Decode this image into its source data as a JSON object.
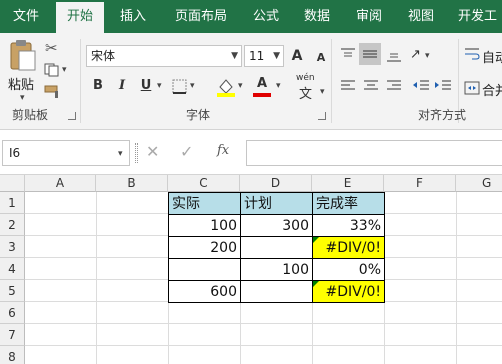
{
  "ribbon": {
    "tabs": [
      "文件",
      "开始",
      "插入",
      "页面布局",
      "公式",
      "数据",
      "审阅",
      "视图",
      "开发工"
    ],
    "active_tab": "开始",
    "clipboard": {
      "paste_label": "粘贴",
      "group_label": "剪贴板"
    },
    "font": {
      "font_name": "宋体",
      "font_size": "11",
      "group_label": "字体",
      "bold": "B",
      "italic": "I",
      "underline": "U",
      "grow": "A",
      "shrink": "A",
      "font_color_letter": "A",
      "wen": "wén",
      "wen_char": "文"
    },
    "alignment": {
      "group_label": "对齐方式",
      "wrap_text": "自动换",
      "merge": "合并"
    }
  },
  "formula_bar": {
    "name_box": "I6",
    "fx": "fx",
    "formula": ""
  },
  "columns": [
    "A",
    "B",
    "C",
    "D",
    "E",
    "F",
    "G"
  ],
  "rows": [
    "1",
    "2",
    "3",
    "4",
    "5",
    "6",
    "7",
    "8"
  ],
  "table": {
    "headers": [
      "实际",
      "计划",
      "完成率"
    ],
    "rows": [
      [
        "100",
        "300",
        "33%"
      ],
      [
        "200",
        "",
        "#DIV/0!"
      ],
      [
        "",
        "100",
        "0%"
      ],
      [
        "600",
        "",
        "#DIV/0!"
      ]
    ]
  },
  "colors": {
    "excel_green": "#217346",
    "header_fill": "#b7dee8",
    "error_fill": "#ffff00"
  }
}
